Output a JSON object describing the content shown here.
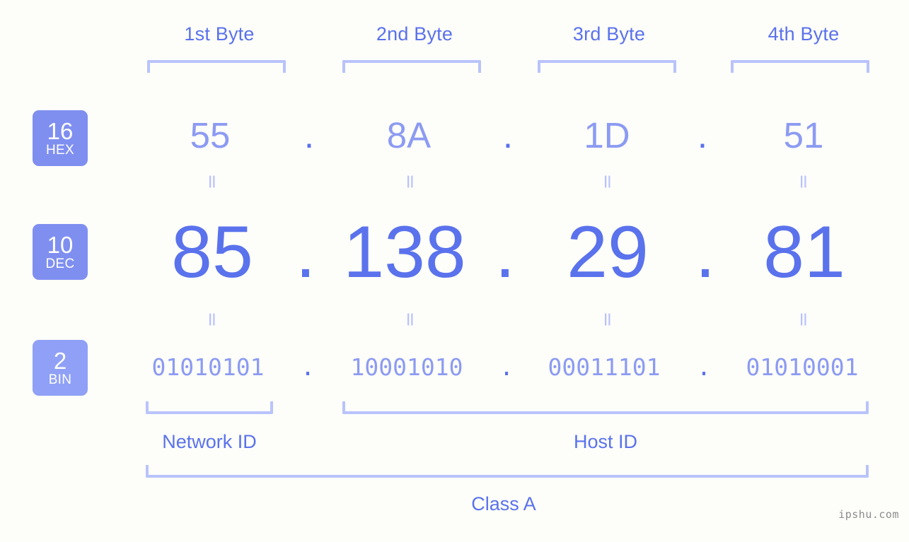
{
  "background": "#fdfdfa",
  "colors": {
    "accent_strong": "#5a72ec",
    "accent_light": "#8c9bf2",
    "bracket": "#b9c3fb",
    "badge_fill": "#7f8ff0",
    "badge_fill_light": "#8fa0f6",
    "watermark": "#8c8c8c"
  },
  "byte_headers": [
    {
      "label": "1st Byte"
    },
    {
      "label": "2nd Byte"
    },
    {
      "label": "3rd Byte"
    },
    {
      "label": "4th Byte"
    }
  ],
  "bases": [
    {
      "number": "16",
      "name": "HEX"
    },
    {
      "number": "10",
      "name": "DEC"
    },
    {
      "number": "2",
      "name": "BIN"
    }
  ],
  "separator": ".",
  "equals_symbol": "=",
  "rows": {
    "hex": {
      "base_number": "16",
      "base_name": "HEX",
      "octets": [
        "55",
        "8A",
        "1D",
        "51"
      ],
      "address": "55.8A.1D.51"
    },
    "dec": {
      "base_number": "10",
      "base_name": "DEC",
      "octets": [
        "85",
        "138",
        "29",
        "81"
      ],
      "address": "85.138.29.81"
    },
    "bin": {
      "base_number": "2",
      "base_name": "BIN",
      "octets": [
        "01010101",
        "10001010",
        "00011101",
        "01010001"
      ],
      "address": "01010101.10001010.00011101.01010001"
    }
  },
  "segments": {
    "network_id": "Network ID",
    "host_id": "Host ID"
  },
  "class_label": "Class A",
  "watermark": "ipshu.com"
}
